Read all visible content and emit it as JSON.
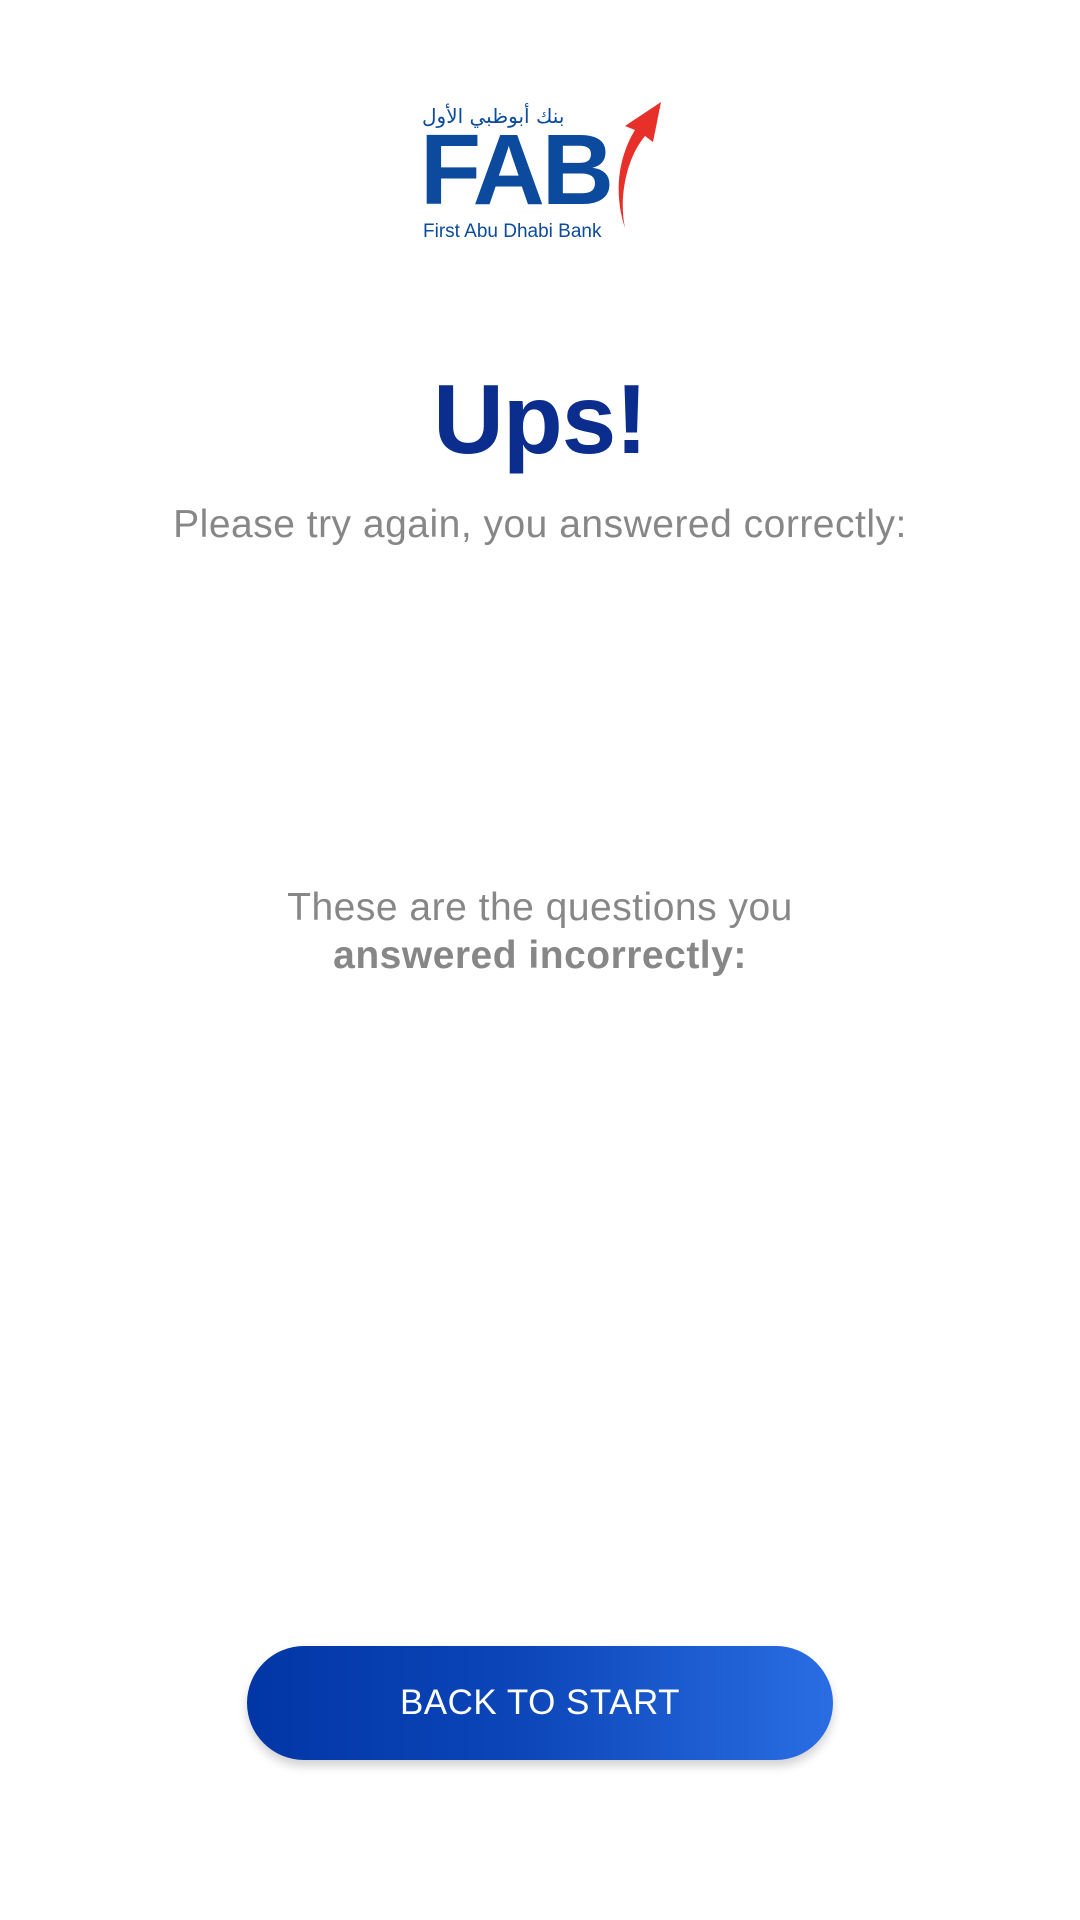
{
  "logo": {
    "arabic_text": "بنك أبوظبي الأول",
    "wordmark": "FAB",
    "tagline": "First Abu Dhabi Bank",
    "brand_blue": "#0b4a9c",
    "brand_red": "#e8302a"
  },
  "result": {
    "title": "Ups!",
    "subtitle": "Please try again, you answered correctly:",
    "incorrect_intro": "These are the questions you",
    "incorrect_bold": "answered incorrectly:"
  },
  "actions": {
    "back_label": "BACK TO START"
  },
  "colors": {
    "title": "#0b2d8e",
    "body_text": "#878787",
    "button_start": "#0236a6",
    "button_end": "#2a6de3"
  }
}
